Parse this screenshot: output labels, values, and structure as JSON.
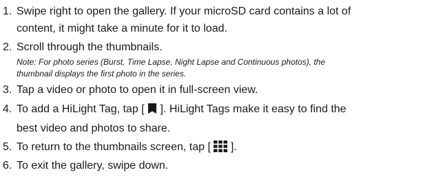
{
  "steps": [
    {
      "number": "1.",
      "lines": [
        "Swipe right to open the gallery. If your microSD card contains a lot of",
        "content, it might take a minute for it to load."
      ]
    },
    {
      "number": "2.",
      "lines": [
        "Scroll through the thumbnails."
      ],
      "note_lines": [
        "Note: For photo series (Burst, Time Lapse, Night Lapse and Continuous photos), the",
        "thumbnail displays the first photo in the series."
      ]
    },
    {
      "number": "3.",
      "lines": [
        "Tap a video or photo to open it in full-screen view."
      ]
    },
    {
      "number": "4.",
      "line1_before_icon": "To add a HiLight Tag, tap [ ",
      "line1_after_icon": " ]. HiLight Tags make it easy to find the",
      "line2": "best video and photos to share.",
      "icon": "hilight-tag-icon"
    },
    {
      "number": "5.",
      "before_icon": "To return to the thumbnails screen, tap [ ",
      "after_icon": " ].",
      "icon": "thumbnails-grid-icon"
    },
    {
      "number": "6.",
      "lines": [
        "To exit the gallery, swipe down."
      ]
    }
  ]
}
